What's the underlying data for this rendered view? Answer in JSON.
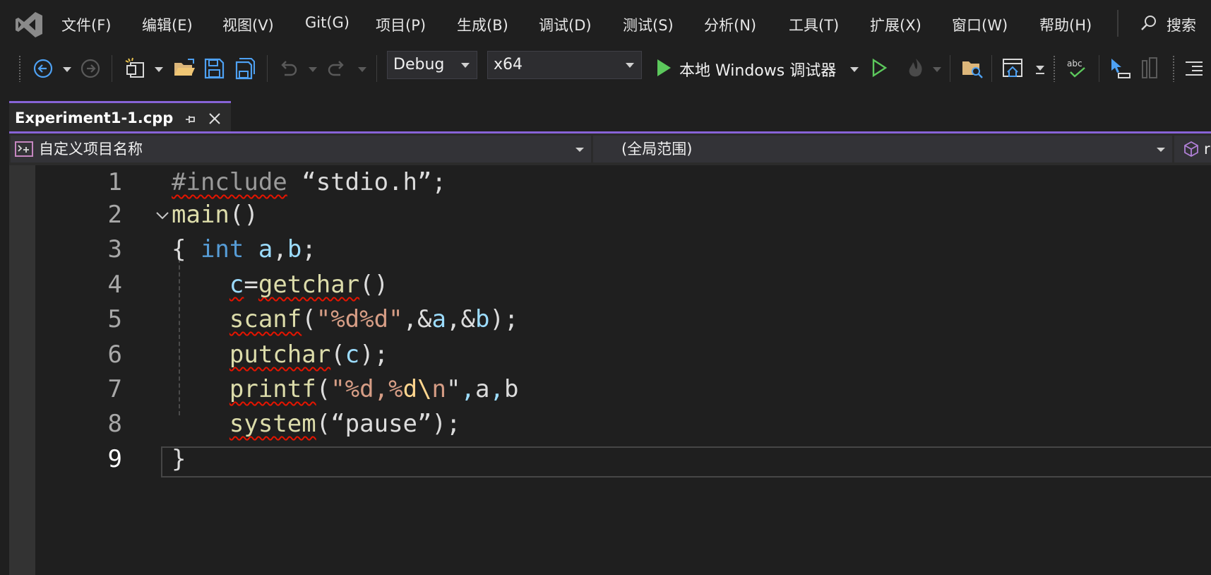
{
  "menu": {
    "items": [
      "文件(F)",
      "编辑(E)",
      "视图(V)",
      "Git(G)",
      "项目(P)",
      "生成(B)",
      "调试(D)",
      "测试(S)",
      "分析(N)",
      "工具(T)",
      "扩展(X)",
      "窗口(W)",
      "帮助(H)"
    ],
    "search_label": "搜索"
  },
  "toolbar": {
    "config": "Debug",
    "platform": "x64",
    "run_label": "本地 Windows 调试器"
  },
  "tab": {
    "title": "Experiment1-1.cpp"
  },
  "navbar": {
    "project": "自定义项目名称",
    "scope": "(全局范围)",
    "member_partial": "r"
  },
  "editor": {
    "line_numbers": [
      "1",
      "2",
      "3",
      "4",
      "5",
      "6",
      "7",
      "8",
      "9"
    ],
    "current_line": 9,
    "lines": [
      "#include “stdio.h”;",
      "main()",
      "{ int a,b;",
      "    c=getchar()",
      "    scanf(\"%d%d\",&a,&b);",
      "    putchar(c);",
      "    printf(\"%d,%d\\n\",a,b)",
      "    system(“pause”);",
      "}"
    ]
  },
  "colors": {
    "accent": "#8763d7",
    "keyword": "#569cd6",
    "function": "#dcdcaa",
    "string": "#d69d85",
    "variable": "#9cdcfe",
    "error_squiggle": "#e51400",
    "run_green": "#5cc85c"
  }
}
